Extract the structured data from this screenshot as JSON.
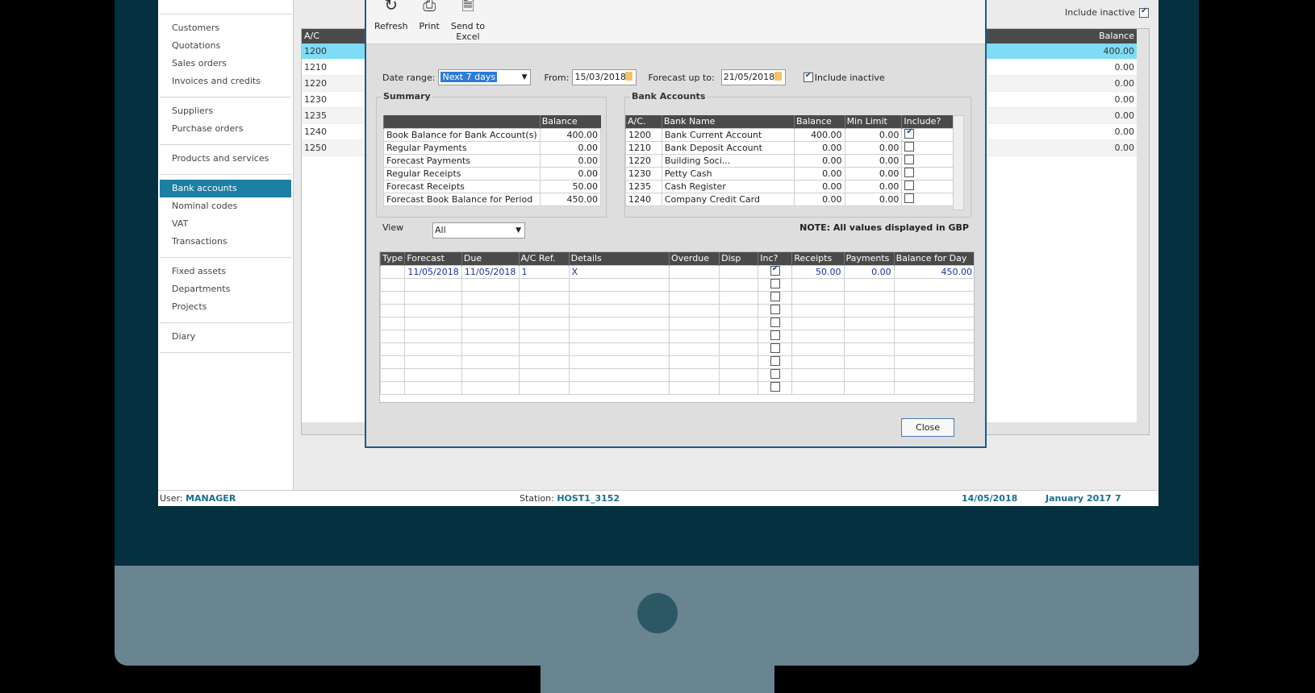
{
  "nav": {
    "groups": [
      [
        "Customers",
        "Quotations",
        "Sales orders",
        "Invoices and credits"
      ],
      [
        "Suppliers",
        "Purchase orders"
      ],
      [
        "Products and services"
      ],
      [
        "Bank accounts",
        "Nominal codes",
        "VAT",
        "Transactions"
      ],
      [
        "Fixed assets",
        "Departments",
        "Projects"
      ],
      [
        "Diary"
      ]
    ],
    "active": "Bank accounts"
  },
  "main": {
    "include_inactive_label": "Include inactive",
    "include_inactive_checked": true,
    "columns": [
      "A/C",
      "Balance"
    ],
    "rows": [
      {
        "ac": "1200",
        "balance": "400.00"
      },
      {
        "ac": "1210",
        "balance": "0.00"
      },
      {
        "ac": "1220",
        "balance": "0.00"
      },
      {
        "ac": "1230",
        "balance": "0.00"
      },
      {
        "ac": "1235",
        "balance": "0.00"
      },
      {
        "ac": "1240",
        "balance": "0.00"
      },
      {
        "ac": "1250",
        "balance": "0.00"
      }
    ]
  },
  "status": {
    "user_label": "User:",
    "user": "MANAGER",
    "station_label": "Station:",
    "station": "HOST1_3152",
    "date": "14/05/2018",
    "period": "January 2017",
    "period_num": "7"
  },
  "dialog": {
    "toolbar": {
      "refresh": "Refresh",
      "print": "Print",
      "send_excel_1": "Send to",
      "send_excel_2": "Excel"
    },
    "date_range_label": "Date range:",
    "date_range_value": "Next 7 days",
    "from_label": "From:",
    "from_value": "15/03/2018",
    "forecast_label": "Forecast up to:",
    "forecast_value": "21/05/2018",
    "include_inactive_label": "Include inactive",
    "include_inactive_checked": true,
    "summary": {
      "title": "Summary",
      "header": [
        "",
        "Balance"
      ],
      "rows": [
        [
          "Book Balance for Bank Account(s)",
          "400.00"
        ],
        [
          "Regular Payments",
          "0.00"
        ],
        [
          "Forecast Payments",
          "0.00"
        ],
        [
          "Regular Receipts",
          "0.00"
        ],
        [
          "Forecast Receipts",
          "50.00"
        ],
        [
          "Forecast Book Balance for Period",
          "450.00"
        ]
      ]
    },
    "bank": {
      "title": "Bank Accounts",
      "header": [
        "A/C.",
        "Bank Name",
        "Balance",
        "Min Limit",
        "Include?"
      ],
      "rows": [
        {
          "ac": "1200",
          "name": "Bank Current Account",
          "balance": "400.00",
          "min": "0.00",
          "inc": true
        },
        {
          "ac": "1210",
          "name": "Bank Deposit Account",
          "balance": "0.00",
          "min": "0.00",
          "inc": false
        },
        {
          "ac": "1220",
          "name": "Building Soci...",
          "balance": "0.00",
          "min": "0.00",
          "inc": false
        },
        {
          "ac": "1230",
          "name": "Petty Cash",
          "balance": "0.00",
          "min": "0.00",
          "inc": false
        },
        {
          "ac": "1235",
          "name": "Cash Register",
          "balance": "0.00",
          "min": "0.00",
          "inc": false
        },
        {
          "ac": "1240",
          "name": "Company Credit Card",
          "balance": "0.00",
          "min": "0.00",
          "inc": false
        }
      ]
    },
    "view_label": "View",
    "view_value": "All",
    "note": "NOTE: All values displayed in GBP",
    "trans": {
      "header": [
        "Type",
        "Forecast",
        "Due",
        "A/C Ref.",
        "Details",
        "Overdue",
        "Disp",
        "Inc?",
        "Receipts",
        "Payments",
        "Balance for Day"
      ],
      "rows": [
        {
          "type": "",
          "forecast": "11/05/2018",
          "due": "11/05/2018",
          "ref": "1",
          "details": "X",
          "overdue": "",
          "disp": "",
          "inc": true,
          "receipts": "50.00",
          "payments": "0.00",
          "balance": "450.00"
        }
      ],
      "empty_rows": 9
    },
    "close": "Close"
  }
}
